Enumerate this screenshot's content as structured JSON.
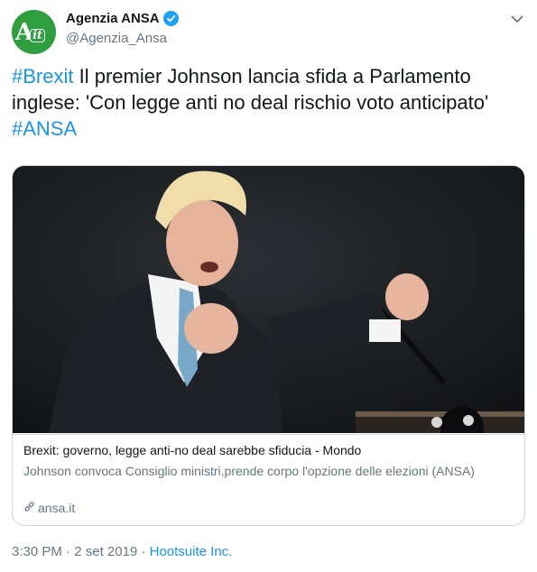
{
  "author": {
    "name": "Agenzia ANSA",
    "handle": "@Agenzia_Ansa",
    "avatar_letter": "A",
    "avatar_badge": "it"
  },
  "tweet": {
    "hashtag1": "#Brexit",
    "body": " Il premier Johnson lancia sfida a Parlamento inglese: 'Con legge anti no deal rischio voto anticipato' ",
    "hashtag2": "#ANSA"
  },
  "card": {
    "title": "Brexit: governo, legge anti-no deal sarebbe sfiducia - Mondo",
    "description": "Johnson convoca Consiglio ministri,prende corpo l'opzione delle elezioni (ANSA)",
    "domain": "ansa.it"
  },
  "footer": {
    "time": "3:30 PM",
    "separator1": " · ",
    "date": "2 set 2019",
    "separator2": " · ",
    "source": "Hootsuite Inc."
  },
  "colors": {
    "link": "#1b95e0",
    "verified": "#1da1f2",
    "avatar_bg": "#2e9e3e",
    "secondary_text": "#657786"
  },
  "icons": [
    "verified-badge-icon",
    "chevron-down-icon",
    "link-icon"
  ]
}
